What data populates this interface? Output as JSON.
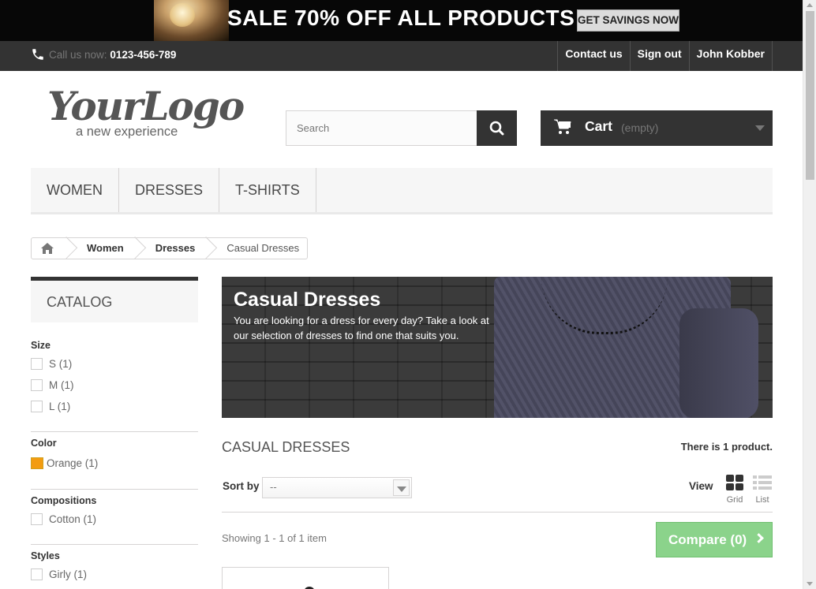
{
  "banner": {
    "sale_text": "SALE 70% OFF ALL PRODUCTS",
    "cta_label": "GET SAVINGS NOW"
  },
  "topnav": {
    "call_label": "Call us now:",
    "phone": "0123-456-789",
    "links": [
      "Contact us",
      "Sign out",
      "John Kobber"
    ]
  },
  "logo": {
    "word": "YourLogo",
    "tagline": "a new experience"
  },
  "search": {
    "placeholder": "Search"
  },
  "cart": {
    "label": "Cart",
    "status": "(empty)"
  },
  "menu": {
    "items": [
      "WOMEN",
      "DRESSES",
      "T-SHIRTS"
    ]
  },
  "breadcrumb": {
    "items": [
      "Women",
      "Dresses",
      "Casual Dresses"
    ]
  },
  "sidebar": {
    "catalog_title": "CATALOG",
    "filters": [
      {
        "title": "Size",
        "items": [
          "S (1)",
          "M (1)",
          "L (1)"
        ]
      },
      {
        "title": "Color",
        "items": [
          "Orange (1)"
        ]
      },
      {
        "title": "Compositions",
        "items": [
          "Cotton (1)"
        ]
      },
      {
        "title": "Styles",
        "items": [
          "Girly (1)"
        ]
      }
    ]
  },
  "category": {
    "title": "Casual Dresses",
    "description": "You are looking for a dress for every day? Take a look at our selection of dresses to find one that suits you.",
    "heading": "CASUAL DRESSES",
    "count_text": "There is 1 product."
  },
  "toolbar": {
    "sort_label": "Sort by",
    "sort_value": "--",
    "view_label": "View",
    "grid_label": "Grid",
    "list_label": "List",
    "showing": "Showing 1 - 1 of 1 item",
    "compare_label": "Compare (0)"
  },
  "colors": {
    "accent_green": "#8bd38b",
    "dark": "#333333",
    "swatch_orange": "#f39c11"
  }
}
